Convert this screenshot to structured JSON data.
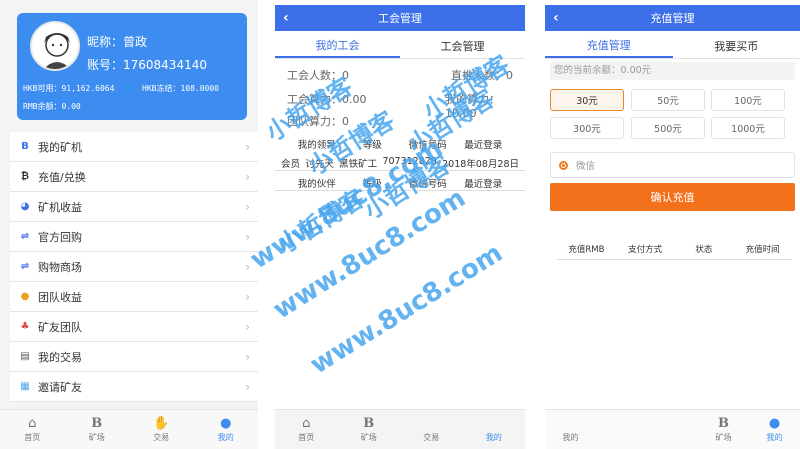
{
  "panel1": {
    "profile": {
      "nickname": "昵称：曾政",
      "account": "账号：17608434140",
      "hkb_available": "HKB可用：91,162.6064",
      "hkb_frozen": "HKB冻结：108.0000",
      "rmb_balance": "RMB余额：0.00"
    },
    "menu": [
      {
        "label": "我的矿机",
        "icon": "B"
      },
      {
        "label": "充值/兑换",
        "icon": "₿"
      },
      {
        "label": "矿机收益",
        "icon": "◕"
      },
      {
        "label": "官方回购",
        "icon": "⇌"
      },
      {
        "label": "购物商场",
        "icon": "⇌"
      },
      {
        "label": "团队收益",
        "icon": "●"
      },
      {
        "label": "矿友团队",
        "icon": "♣"
      },
      {
        "label": "我的交易",
        "icon": "▤"
      },
      {
        "label": "邀请矿友",
        "icon": "▦"
      }
    ],
    "tabs": [
      "首页",
      "矿场",
      "交易",
      "我的"
    ]
  },
  "panel2": {
    "title": "工会管理",
    "subtabs": [
      "我的工会",
      "工会管理"
    ],
    "union_count": "工会人数：0",
    "direct_count": "直推人数：0",
    "union_hash": "工会算力：0.00",
    "my_hash": "我的算力：10.00",
    "team_hash": "团队算力：0",
    "leader_header": [
      "我的领导",
      "等级",
      "微信号码",
      "最近登录"
    ],
    "leader_row": [
      "会员",
      "讨先天",
      "黑铁矿工",
      "707312829",
      "2018年08月28日"
    ],
    "partner_header": [
      "我的伙伴",
      "等级",
      "微信号码",
      "最近登录"
    ],
    "tabs": [
      "首页",
      "矿场",
      "交易",
      "我的"
    ]
  },
  "panel3": {
    "title": "充值管理",
    "subtabs": [
      "充值管理",
      "我要买币"
    ],
    "balance": "您的当前余额：0.00元",
    "amounts": [
      "30元",
      "50元",
      "100元",
      "300元",
      "500元",
      "1000元"
    ],
    "pay_method": "微信",
    "confirm": "确认充值",
    "table_headers": [
      "充值RMB",
      "支付方式",
      "状态",
      "充值时间"
    ],
    "tabs": [
      "我的",
      "矿场",
      "我的"
    ]
  },
  "watermark": {
    "cn": "小哲博客",
    "url": "www.8uc8.com"
  },
  "colors": {
    "primary": "#3d6fe8",
    "card": "#3d8df0",
    "accent": "#f4711c",
    "watermark": "#4aa6ef"
  }
}
